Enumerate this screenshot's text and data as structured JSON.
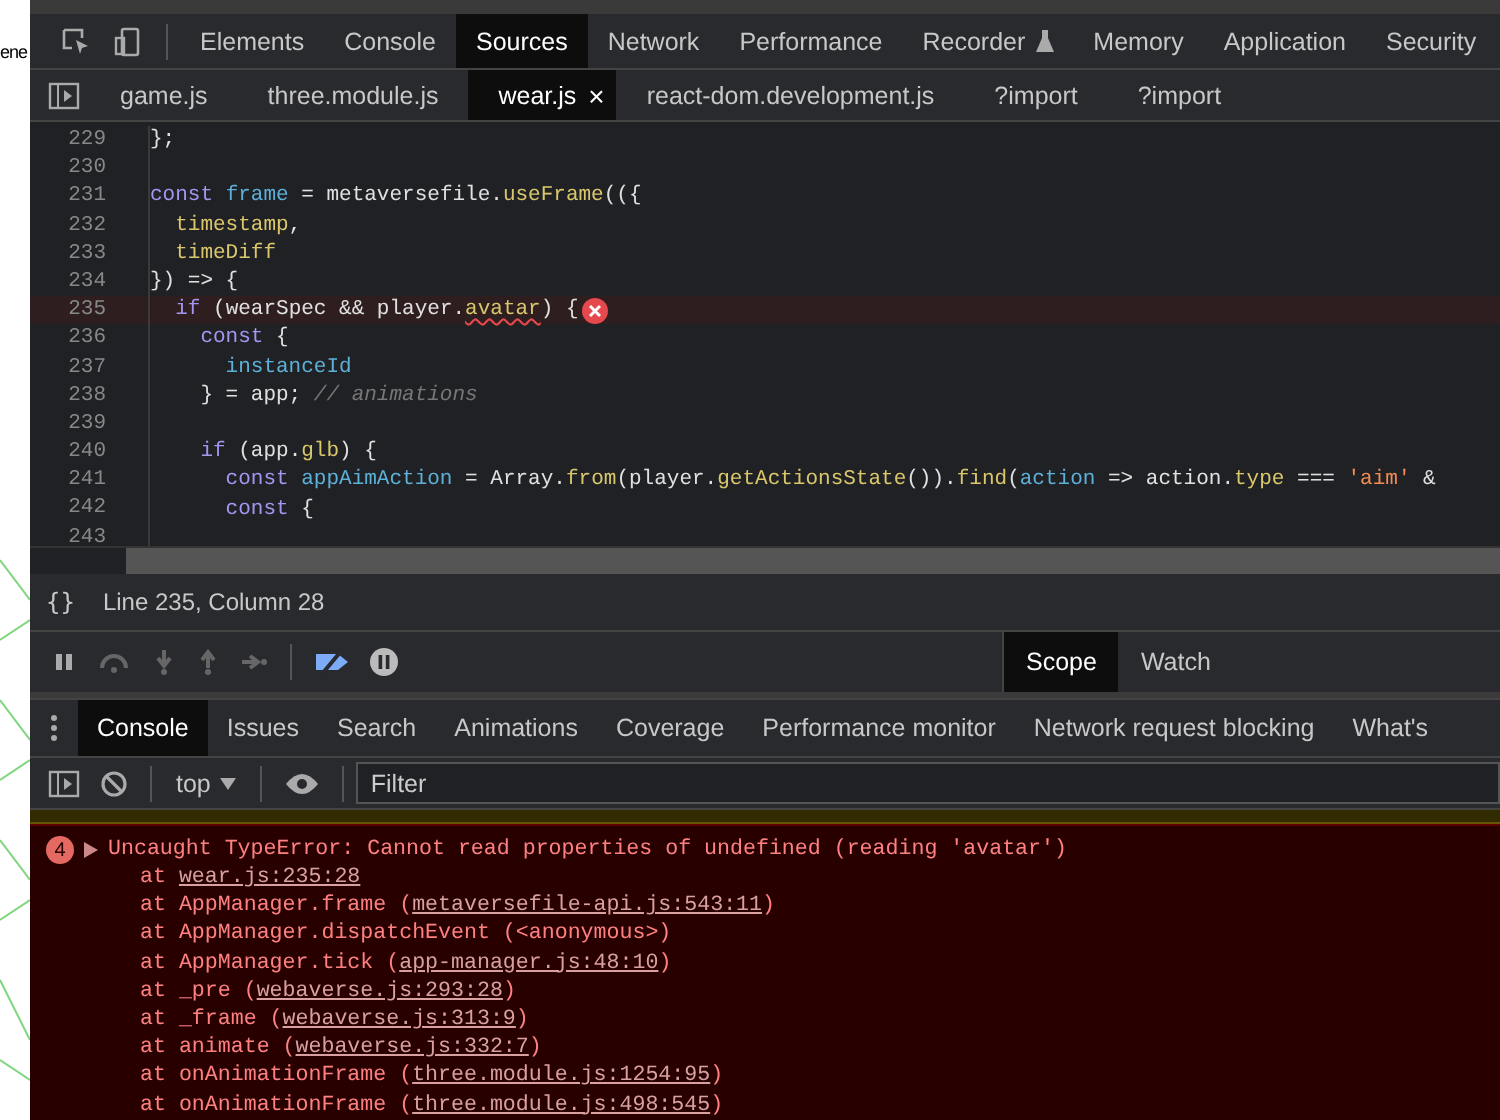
{
  "page_behind": {
    "text": "ene"
  },
  "main_tabs": [
    {
      "label": "Elements",
      "selected": false
    },
    {
      "label": "Console",
      "selected": false
    },
    {
      "label": "Sources",
      "selected": true
    },
    {
      "label": "Network",
      "selected": false
    },
    {
      "label": "Performance",
      "selected": false
    },
    {
      "label": "Recorder",
      "selected": false,
      "kind": "flask"
    },
    {
      "label": "Memory",
      "selected": false
    },
    {
      "label": "Application",
      "selected": false
    },
    {
      "label": "Security",
      "selected": false
    }
  ],
  "file_tabs": [
    {
      "label": "game.js",
      "selected": false
    },
    {
      "label": "three.module.js",
      "selected": false
    },
    {
      "label": "wear.js",
      "selected": true,
      "close": "×"
    },
    {
      "label": "react-dom.development.js",
      "selected": false
    },
    {
      "label": "?import",
      "selected": false
    },
    {
      "label": "?import",
      "selected": false
    }
  ],
  "code_lines": [
    {
      "number": "229",
      "error": false,
      "tokens": [
        {
          "kind": "plain",
          "text": "};"
        }
      ]
    },
    {
      "number": "230",
      "error": false
    },
    {
      "number": "231",
      "error": false,
      "tokens": [
        {
          "kind": "kw",
          "text": "const "
        },
        {
          "kind": "def",
          "text": "frame"
        },
        {
          "kind": "plain",
          "text": " = metaversefile."
        },
        {
          "kind": "prop",
          "text": "useFrame"
        },
        {
          "kind": "plain",
          "text": "(({"
        }
      ]
    },
    {
      "number": "232",
      "error": false,
      "tokens": [
        {
          "kind": "prop",
          "text": "  timestamp"
        },
        {
          "kind": "plain",
          "text": ","
        }
      ]
    },
    {
      "number": "233",
      "error": false,
      "tokens": [
        {
          "kind": "prop",
          "text": "  timeDiff"
        }
      ]
    },
    {
      "number": "234",
      "error": false,
      "tokens": [
        {
          "kind": "plain",
          "text": "}) => {"
        }
      ]
    },
    {
      "number": "235",
      "error": true,
      "tokens": [
        {
          "kind": "kw",
          "text": "  if"
        },
        {
          "kind": "plain",
          "text": " (wearSpec && player."
        },
        {
          "kind": "err",
          "text": "avatar"
        },
        {
          "kind": "plain",
          "text": ") {"
        }
      ]
    },
    {
      "number": "236",
      "error": false,
      "tokens": [
        {
          "kind": "kw",
          "text": "    const"
        },
        {
          "kind": "plain",
          "text": " {"
        }
      ]
    },
    {
      "number": "237",
      "error": false,
      "tokens": [
        {
          "kind": "def",
          "text": "      instanceId"
        }
      ]
    },
    {
      "number": "238",
      "error": false,
      "tokens": [
        {
          "kind": "plain",
          "text": "    } = app; "
        },
        {
          "kind": "com",
          "text": "// animations"
        }
      ]
    },
    {
      "number": "239",
      "error": false
    },
    {
      "number": "240",
      "error": false,
      "tokens": [
        {
          "kind": "kw",
          "text": "    if"
        },
        {
          "kind": "plain",
          "text": " (app."
        },
        {
          "kind": "prop",
          "text": "glb"
        },
        {
          "kind": "plain",
          "text": ") {"
        }
      ]
    },
    {
      "number": "241",
      "error": false,
      "tokens": [
        {
          "kind": "kw",
          "text": "      const "
        },
        {
          "kind": "def",
          "text": "appAimAction"
        },
        {
          "kind": "plain",
          "text": " = Array."
        },
        {
          "kind": "prop",
          "text": "from"
        },
        {
          "kind": "plain",
          "text": "(player."
        },
        {
          "kind": "prop",
          "text": "getActionsState"
        },
        {
          "kind": "plain",
          "text": "())."
        },
        {
          "kind": "prop",
          "text": "find"
        },
        {
          "kind": "plain",
          "text": "("
        },
        {
          "kind": "def",
          "text": "action"
        },
        {
          "kind": "plain",
          "text": " => action."
        },
        {
          "kind": "prop",
          "text": "type"
        },
        {
          "kind": "plain",
          "text": " === "
        },
        {
          "kind": "str",
          "text": "'aim'"
        },
        {
          "kind": "plain",
          "text": " &"
        }
      ]
    },
    {
      "number": "242",
      "error": false,
      "tokens": [
        {
          "kind": "kw",
          "text": "      const"
        },
        {
          "kind": "plain",
          "text": " {"
        }
      ]
    },
    {
      "number": "243",
      "error": false
    }
  ],
  "status_bar": {
    "pretty_print": "{}",
    "position": "Line 235, Column 28"
  },
  "sidebar_tabs": [
    {
      "label": "Scope",
      "selected": true
    },
    {
      "label": "Watch",
      "selected": false
    }
  ],
  "drawer_tabs": [
    {
      "label": "Console",
      "selected": true
    },
    {
      "label": "Issues",
      "selected": false
    },
    {
      "label": "Search",
      "selected": false
    },
    {
      "label": "Animations",
      "selected": false
    },
    {
      "label": "Coverage",
      "selected": false
    },
    {
      "label": "Performance monitor",
      "selected": false
    },
    {
      "label": "Network request blocking",
      "selected": false
    },
    {
      "label": "What's",
      "selected": false
    }
  ],
  "console_toolbar": {
    "context": "top",
    "filter": {
      "placeholder": "Filter"
    }
  },
  "error": {
    "count": "4",
    "message": "Uncaught TypeError: Cannot read properties of undefined (reading 'avatar')",
    "stack": [
      {
        "text": "at ",
        "link": "wear.js:235:28"
      },
      {
        "text": "at AppManager.frame (",
        "link": "metaversefile-api.js:543:11",
        "after": ")"
      },
      {
        "text": "at AppManager.dispatchEvent (<anonymous>)"
      },
      {
        "text": "at AppManager.tick (",
        "link": "app-manager.js:48:10",
        "after": ")"
      },
      {
        "text": "at _pre (",
        "link": "webaverse.js:293:28",
        "after": ")"
      },
      {
        "text": "at _frame (",
        "link": "webaverse.js:313:9",
        "after": ")"
      },
      {
        "text": "at animate (",
        "link": "webaverse.js:332:7",
        "after": ")"
      },
      {
        "text": "at onAnimationFrame (",
        "link": "three.module.js:1254:95",
        "after": ")"
      },
      {
        "text": "at onAnimationFrame (",
        "link": "three.module.js:498:545",
        "after": ")"
      }
    ]
  }
}
